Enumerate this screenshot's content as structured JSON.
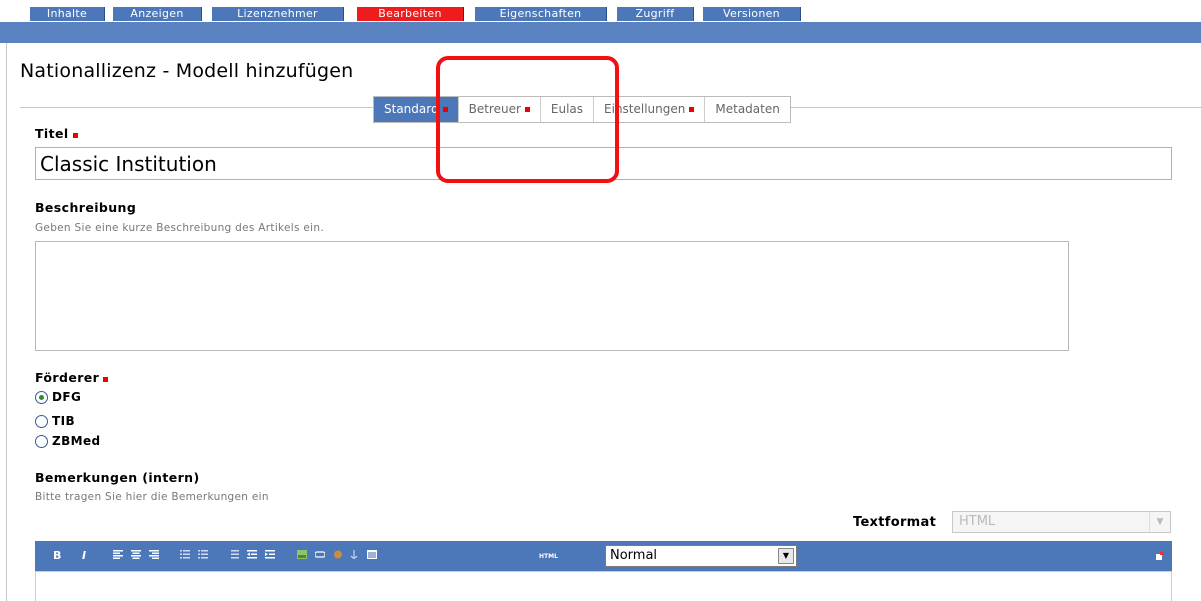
{
  "topnav": {
    "tabs": [
      {
        "label": "Inhalte"
      },
      {
        "label": "Anzeigen"
      },
      {
        "label": "Lizenznehmer"
      },
      {
        "label": "Bearbeiten",
        "active": true
      },
      {
        "label": "Eigenschaften"
      },
      {
        "label": "Zugriff"
      },
      {
        "label": "Versionen"
      }
    ]
  },
  "page": {
    "title": "Nationallizenz - Modell hinzufügen"
  },
  "subtabs": [
    {
      "label": "Standard",
      "required": true,
      "active": true
    },
    {
      "label": "Betreuer",
      "required": true
    },
    {
      "label": "Eulas",
      "required": false
    },
    {
      "label": "Einstellungen",
      "required": true
    },
    {
      "label": "Metadaten",
      "required": false
    }
  ],
  "form": {
    "titel": {
      "label": "Titel",
      "value": "Classic Institution"
    },
    "beschreibung": {
      "label": "Beschreibung",
      "hint": "Geben Sie eine kurze Beschreibung des Artikels ein.",
      "value": ""
    },
    "foerderer": {
      "label": "Förderer",
      "options": [
        {
          "label": "DFG",
          "checked": true
        },
        {
          "label": "TIB",
          "checked": false
        },
        {
          "label": "ZBMed",
          "checked": false
        }
      ]
    },
    "bemerkungen": {
      "label": "Bemerkungen (intern)",
      "hint": "Bitte tragen Sie hier die Bemerkungen ein"
    },
    "textformat": {
      "label": "Textformat",
      "value": "HTML"
    }
  },
  "editor": {
    "bold": "B",
    "italic": "I",
    "html_label": "HTML",
    "format_value": "Normal"
  },
  "colors": {
    "accent_blue": "#4c78ba",
    "active_red": "#ee1c1c",
    "highlight_red": "#f21010",
    "input_border": "#f0a830"
  }
}
